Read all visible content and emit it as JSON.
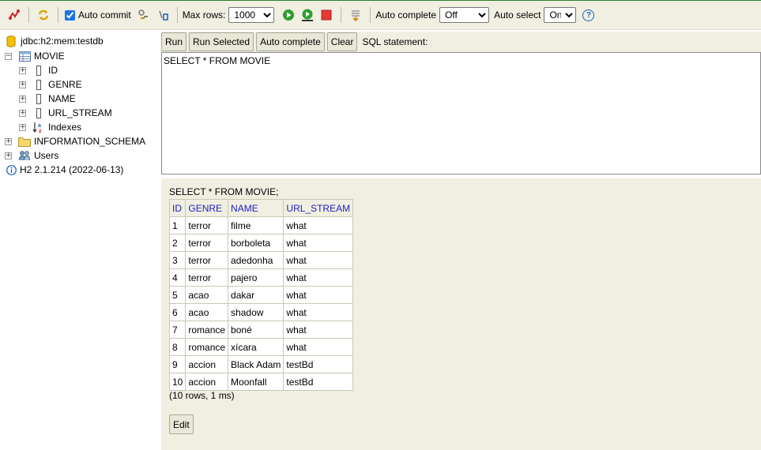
{
  "toolbar": {
    "auto_commit_label": "Auto commit",
    "auto_commit_checked": true,
    "max_rows_label": "Max rows:",
    "max_rows_value": "1000",
    "auto_complete_label": "Auto complete",
    "auto_complete_value": "Off",
    "auto_select_label": "Auto select",
    "auto_select_value": "On",
    "help_glyph": "?"
  },
  "tree": {
    "connection": "jdbc:h2:mem:testdb",
    "table": "MOVIE",
    "columns": [
      "ID",
      "GENRE",
      "NAME",
      "URL_STREAM"
    ],
    "indexes": "Indexes",
    "schema": "INFORMATION_SCHEMA",
    "users": "Users",
    "version": "H2 2.1.214 (2022-06-13)"
  },
  "sql": {
    "run": "Run",
    "run_selected": "Run Selected",
    "auto_complete": "Auto complete",
    "clear": "Clear",
    "statement_label": "SQL statement:",
    "editor_text": "SELECT * FROM MOVIE"
  },
  "results": {
    "statement": "SELECT * FROM MOVIE;",
    "headers": [
      "ID",
      "GENRE",
      "NAME",
      "URL_STREAM"
    ],
    "rows": [
      [
        "1",
        "terror",
        "filme",
        "what"
      ],
      [
        "2",
        "terror",
        "borboleta",
        "what"
      ],
      [
        "3",
        "terror",
        "adedonha",
        "what"
      ],
      [
        "4",
        "terror",
        "pajero",
        "what"
      ],
      [
        "5",
        "acao",
        "dakar",
        "what"
      ],
      [
        "6",
        "acao",
        "shadow",
        "what"
      ],
      [
        "7",
        "romance",
        "boné",
        "what"
      ],
      [
        "8",
        "romance",
        "xícara",
        "what"
      ],
      [
        "9",
        "accion",
        "Black Adam",
        "testBd"
      ],
      [
        "10",
        "accion",
        "Moonfall",
        "testBd"
      ]
    ],
    "row_info": "(10 rows, 1 ms)",
    "edit": "Edit"
  }
}
